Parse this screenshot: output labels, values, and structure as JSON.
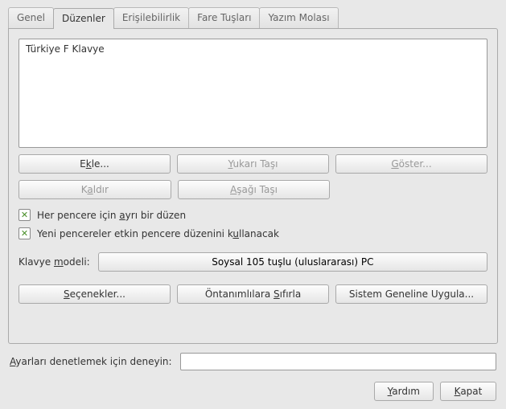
{
  "tabs": {
    "genel": "Genel",
    "duzenler": "Düzenler",
    "erisilebilirlik": "Erişilebilirlik",
    "fare": "Fare Tuşları",
    "yazim": "Yazım Molası"
  },
  "layouts": {
    "items": [
      "Türkiye F Klavye"
    ]
  },
  "buttons": {
    "ekle_pre": "E",
    "ekle_u": "k",
    "ekle_post": "le...",
    "yukari_pre": "",
    "yukari_u": "Y",
    "yukari_post": "ukarı Taşı",
    "goster_pre": "",
    "goster_u": "G",
    "goster_post": "öster...",
    "kaldir_pre": "K",
    "kaldir_u": "a",
    "kaldir_post": "ldır",
    "asagi_pre": "",
    "asagi_u": "A",
    "asagi_post": "şağı Taşı"
  },
  "checks": {
    "per_window_pre": "Her pencere için ",
    "per_window_u": "a",
    "per_window_post": "yrı bir düzen",
    "new_window_pre": "Yeni pencereler etkin pencere düzenini k",
    "new_window_u": "u",
    "new_window_post": "llanacak"
  },
  "model": {
    "label_pre": "Klavye ",
    "label_u": "m",
    "label_post": "odeli:",
    "value": "Soysal 105 tuşlu (uluslararası) PC"
  },
  "actions": {
    "secenekler_pre": "",
    "secenekler_u": "S",
    "secenekler_post": "eçenekler...",
    "sifirla_pre": "Öntanımlılara ",
    "sifirla_u": "S",
    "sifirla_post": "ıfırla",
    "sistem": "Sistem Geneline Uygula..."
  },
  "test": {
    "label_pre": "",
    "label_u": "A",
    "label_post": "yarları denetlemek için deneyin:",
    "value": ""
  },
  "footer": {
    "yardim_pre": "",
    "yardim_u": "Y",
    "yardim_post": "ardım",
    "kapat_pre": "",
    "kapat_u": "K",
    "kapat_post": "apat"
  }
}
